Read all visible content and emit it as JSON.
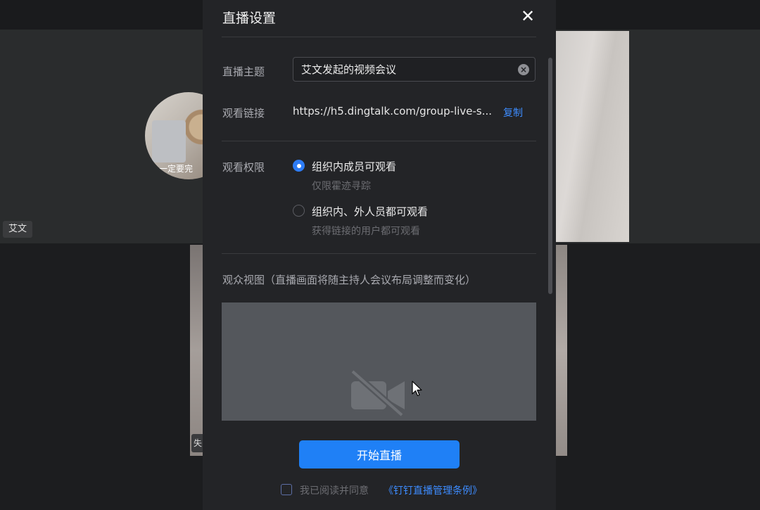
{
  "meeting": {
    "participant_name": "艾文",
    "avatar_caption": "一定要完",
    "strip_badge": "失"
  },
  "dialog": {
    "title": "直播设置",
    "close_glyph": "✕",
    "topic": {
      "label": "直播主题",
      "value": "艾文发起的视频会议"
    },
    "watch_link": {
      "label": "观看链接",
      "url": "https://h5.dingtalk.com/group-live-s...",
      "copy_label": "复制"
    },
    "permission": {
      "label": "观看权限",
      "options": [
        {
          "label": "组织内成员可观看",
          "sub": "仅限霍迹寻踪",
          "selected": true
        },
        {
          "label": "组织内、外人员都可观看",
          "sub": "获得链接的用户都可观看",
          "selected": false
        }
      ]
    },
    "audience_view": {
      "label": "观众视图（直播画面将随主持人会议布局调整而变化）",
      "camera_icon": "camera-off-icon"
    },
    "start_button": "开始直播",
    "agreement": {
      "text": "我已阅读并同意",
      "link": "《钉钉直播管理条例》",
      "checked": false
    }
  },
  "colors": {
    "accent": "#1f80f6",
    "link": "#3d8cff",
    "dialog_bg": "#232427"
  }
}
